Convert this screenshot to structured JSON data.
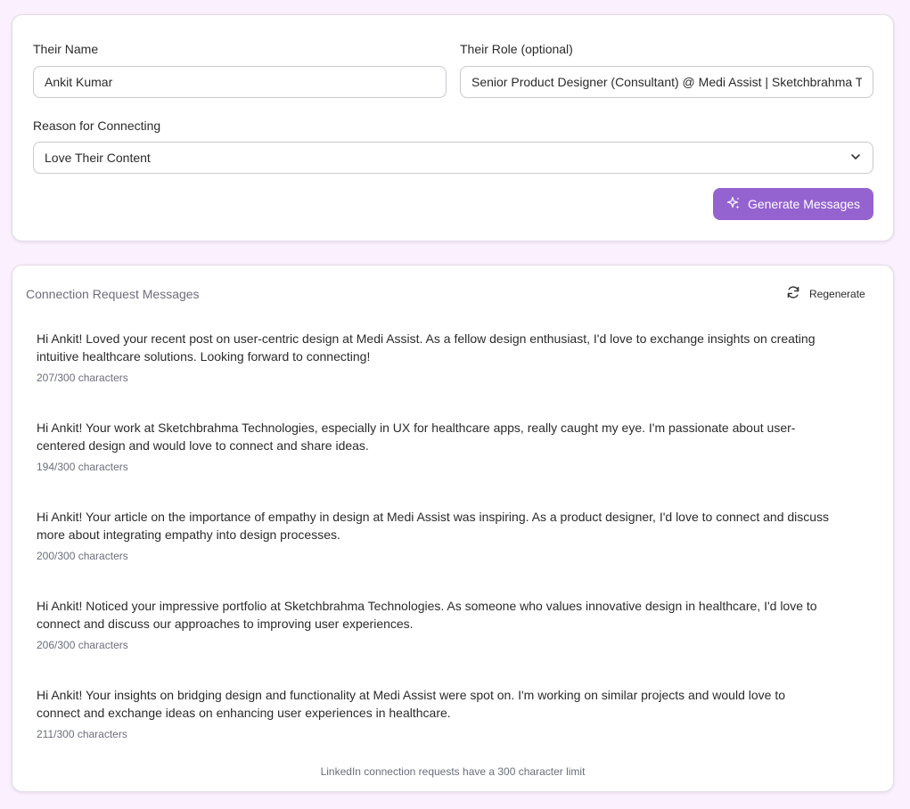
{
  "form": {
    "name_label": "Their Name",
    "name_value": "Ankit Kumar",
    "role_label": "Their Role (optional)",
    "role_value": "Senior Product Designer (Consultant) @ Medi Assist | Sketchbrahma Technologies",
    "reason_label": "Reason for Connecting",
    "reason_selected": "Love Their Content",
    "generate_label": "Generate Messages"
  },
  "messages_section": {
    "title": "Connection Request Messages",
    "regenerate_label": "Regenerate",
    "messages": [
      {
        "text": "Hi Ankit! Loved your recent post on user-centric design at Medi Assist. As a fellow design enthusiast, I'd love to exchange insights on creating intuitive healthcare solutions. Looking forward to connecting!",
        "count": "207/300 characters"
      },
      {
        "text": "Hi Ankit! Your work at Sketchbrahma Technologies, especially in UX for healthcare apps, really caught my eye. I'm passionate about user-centered design and would love to connect and share ideas.",
        "count": "194/300 characters"
      },
      {
        "text": "Hi Ankit! Your article on the importance of empathy in design at Medi Assist was inspiring. As a product designer, I'd love to connect and discuss more about integrating empathy into design processes.",
        "count": "200/300 characters"
      },
      {
        "text": "Hi Ankit! Noticed your impressive portfolio at Sketchbrahma Technologies. As someone who values innovative design in healthcare, I'd love to connect and discuss our approaches to improving user experiences.",
        "count": "206/300 characters"
      },
      {
        "text": "Hi Ankit! Your insights on bridging design and functionality at Medi Assist were spot on. I'm working on similar projects and would love to connect and exchange ideas on enhancing user experiences in healthcare.",
        "count": "211/300 characters"
      }
    ],
    "footer_note": "LinkedIn connection requests have a 300 character limit"
  },
  "icons": {
    "generate": "sparkles-icon",
    "regenerate": "refresh-icon",
    "select": "chevron-down-icon"
  },
  "colors": {
    "accent": "#9463d0",
    "background": "#fbf0fe"
  }
}
